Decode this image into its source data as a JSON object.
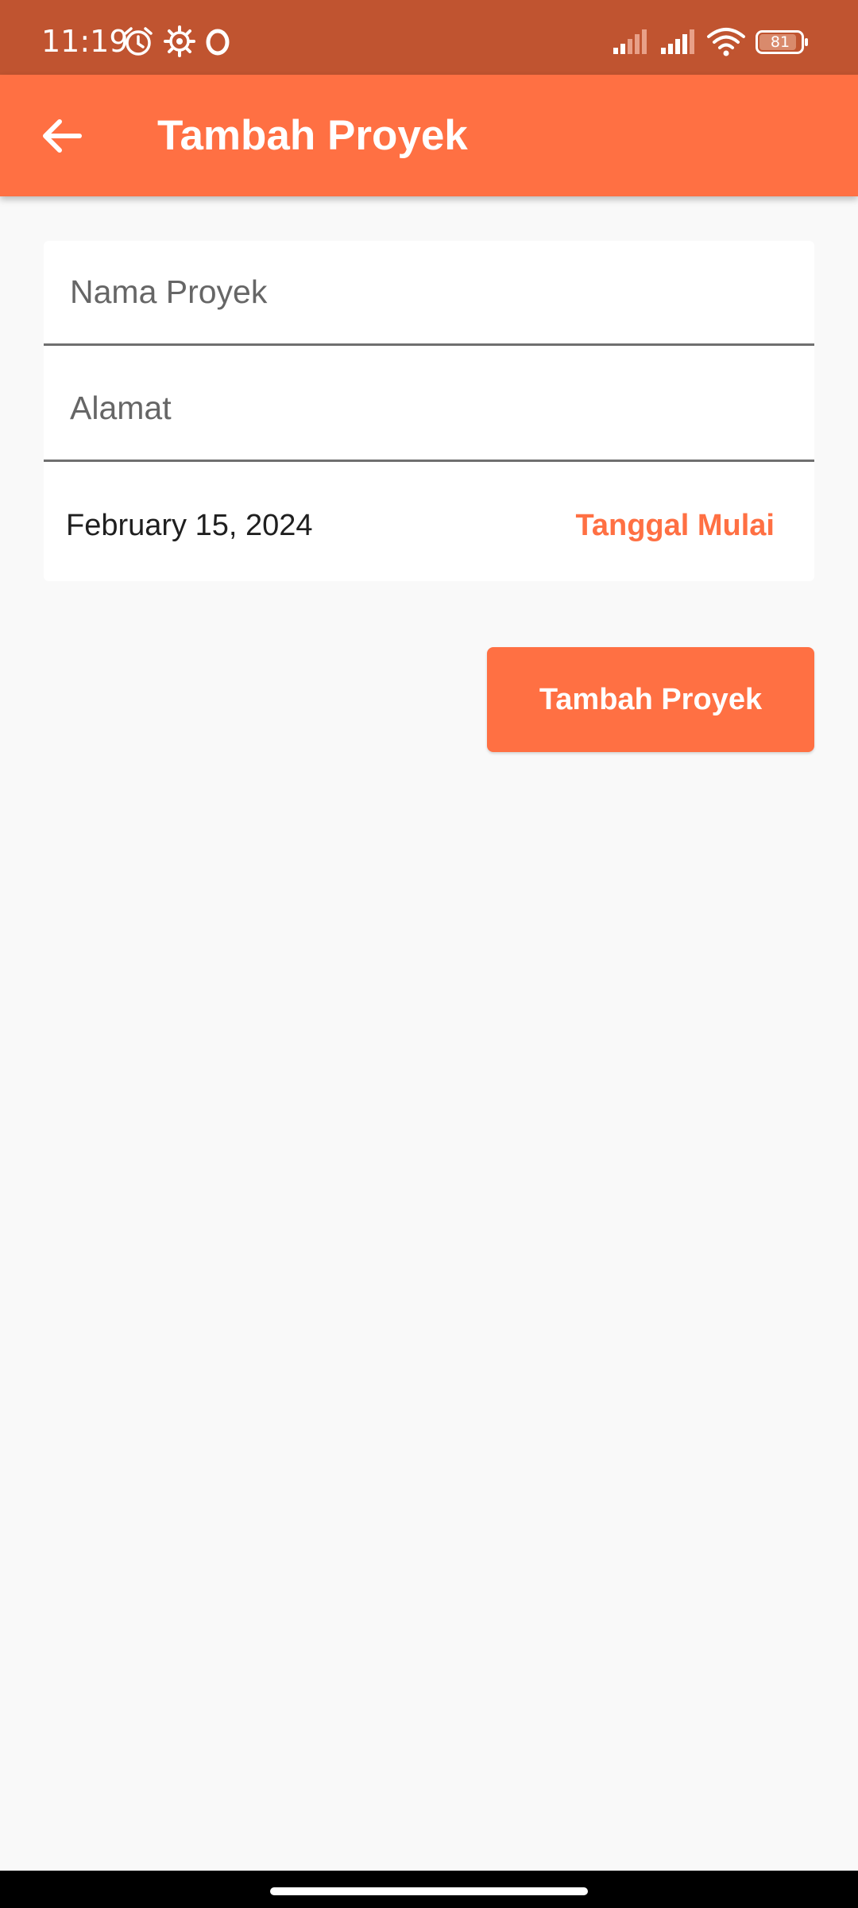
{
  "status_bar": {
    "time": "11:19",
    "battery": "81",
    "icons": [
      "alarm-icon",
      "settings-gear-icon",
      "opera-icon",
      "signal-icon",
      "signal-icon",
      "wifi-icon",
      "battery-icon"
    ]
  },
  "app_bar": {
    "title": "Tambah Proyek",
    "back_icon": "arrow-left-icon"
  },
  "form": {
    "nama_proyek": {
      "placeholder": "Nama Proyek",
      "value": ""
    },
    "alamat": {
      "placeholder": "Alamat",
      "value": ""
    },
    "date_value": "February 15, 2024",
    "date_button_label": "Tanggal Mulai"
  },
  "submit_button": {
    "label": "Tambah Proyek"
  },
  "colors": {
    "status_bar": "#c05430",
    "primary": "#ff7043",
    "background": "#f9f9f9"
  }
}
